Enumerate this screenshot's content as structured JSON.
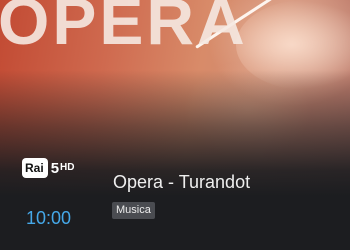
{
  "hero": {
    "overlay_text": "OPERA"
  },
  "channel": {
    "logo_brand": "Rai",
    "logo_number": "5",
    "logo_suffix": "HD"
  },
  "program": {
    "title": "Opera - Turandot",
    "genre": "Musica",
    "start_time": "10:00"
  },
  "colors": {
    "background": "#1c1d20",
    "time_accent": "#45a8e8",
    "badge_bg": "#4a4c51"
  }
}
